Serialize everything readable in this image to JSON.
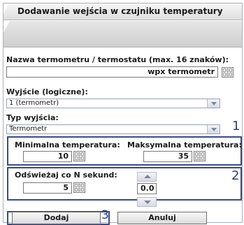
{
  "dialog": {
    "title": "Dodawanie wejścia w czujniku temperatury"
  },
  "form": {
    "name_label": "Nazwa termometru / termostatu (max. 16 znaków):",
    "name_value": "wpx termometr",
    "output_label": "Wyjście (logiczne):",
    "output_selected": "1 (termometr)",
    "type_label": "Typ wyjścia:",
    "type_selected": "Termometr",
    "min_label": "Minimalna temperatura:",
    "min_value": "10",
    "max_label": "Maksymalna temperatura:",
    "max_value": "35",
    "refresh_label": "Odświeżaj co N sekund:",
    "refresh_value": "5",
    "offset_value": "0.0"
  },
  "buttons": {
    "add_label": "Dodaj",
    "cancel_label": "Anuluj"
  },
  "annotations": {
    "box1": "1",
    "box2": "2",
    "box3": "3"
  },
  "colors": {
    "annotation": "#3a4a8a",
    "select_border": "#9aa3b5"
  }
}
